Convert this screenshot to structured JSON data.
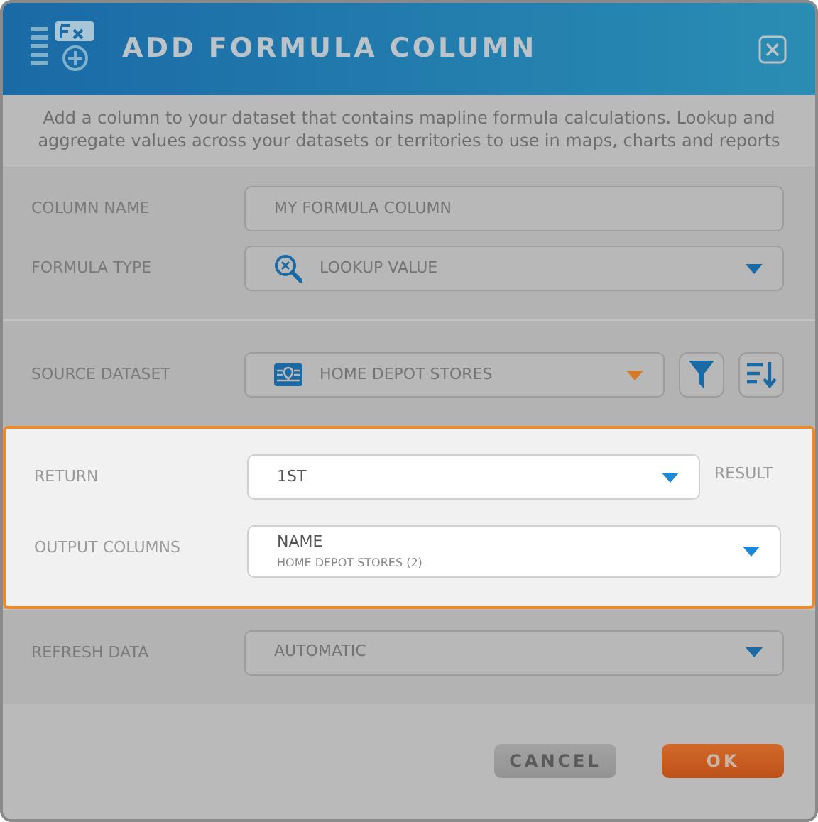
{
  "dialog": {
    "title": "ADD FORMULA COLUMN",
    "description": "Add a column to your dataset that contains mapline formula calculations. Lookup and aggregate values across your datasets or territories to use in maps, charts and reports",
    "sections": [
      {
        "highlighted": false,
        "fields": [
          {
            "label": "COLUMN NAME",
            "kind": "text",
            "value": "MY FORMULA COLUMN"
          },
          {
            "label": "FORMULA TYPE",
            "kind": "type-select",
            "value": "LOOKUP VALUE"
          }
        ]
      },
      {
        "highlighted": false,
        "fields": [
          {
            "label": "SOURCE DATASET",
            "kind": "dataset-select",
            "value": "HOME DEPOT STORES"
          }
        ]
      },
      {
        "highlighted": true,
        "fields": [
          {
            "label": "RETURN",
            "kind": "select",
            "value": "1ST",
            "suffix": "RESULT"
          },
          {
            "label": "OUTPUT COLUMNS",
            "kind": "select",
            "value": "NAME",
            "subvalue": "HOME DEPOT STORES (2)"
          }
        ]
      },
      {
        "highlighted": false,
        "fields": [
          {
            "label": "REFRESH DATA",
            "kind": "select",
            "value": "AUTOMATIC"
          }
        ]
      }
    ],
    "buttons": [
      {
        "label": "CANCEL",
        "kind": "secondary"
      },
      {
        "label": "OK",
        "kind": "primary"
      }
    ]
  }
}
